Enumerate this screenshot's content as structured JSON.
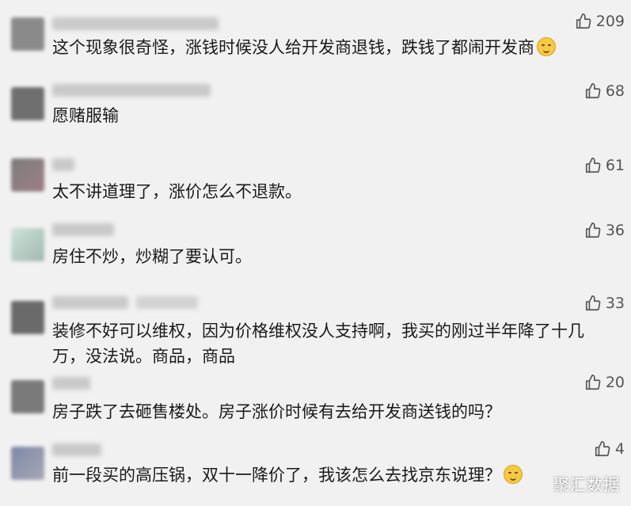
{
  "comments": [
    {
      "text": "这个现象很奇怪，涨钱时候没人给开发商退钱，跌钱了都闹开发商",
      "emoji": "smile-emoji",
      "likes": "209"
    },
    {
      "text": "愿赌服输",
      "likes": "68"
    },
    {
      "text": "太不讲道理了，涨价怎么不退款。",
      "likes": "61"
    },
    {
      "text": "房住不炒，炒糊了要认可。",
      "likes": "36"
    },
    {
      "text": "装修不好可以维权，因为价格维权没人支持啊，我买的刚过半年降了十几万，没法说。商品，商品",
      "likes": "33"
    },
    {
      "text": "房子跌了去砸售楼处。房子涨价时候有去给开发商送钱的吗？",
      "likes": "20"
    },
    {
      "text": "前一段买的高压锅，双十一降价了，我该怎么去找京东说理？",
      "emoji": "smile-emoji",
      "likes": "4"
    }
  ],
  "watermark": "聚汇数据",
  "colors": {
    "background": "#f1f1f1",
    "text": "#1a1a1a",
    "like": "#555555"
  }
}
